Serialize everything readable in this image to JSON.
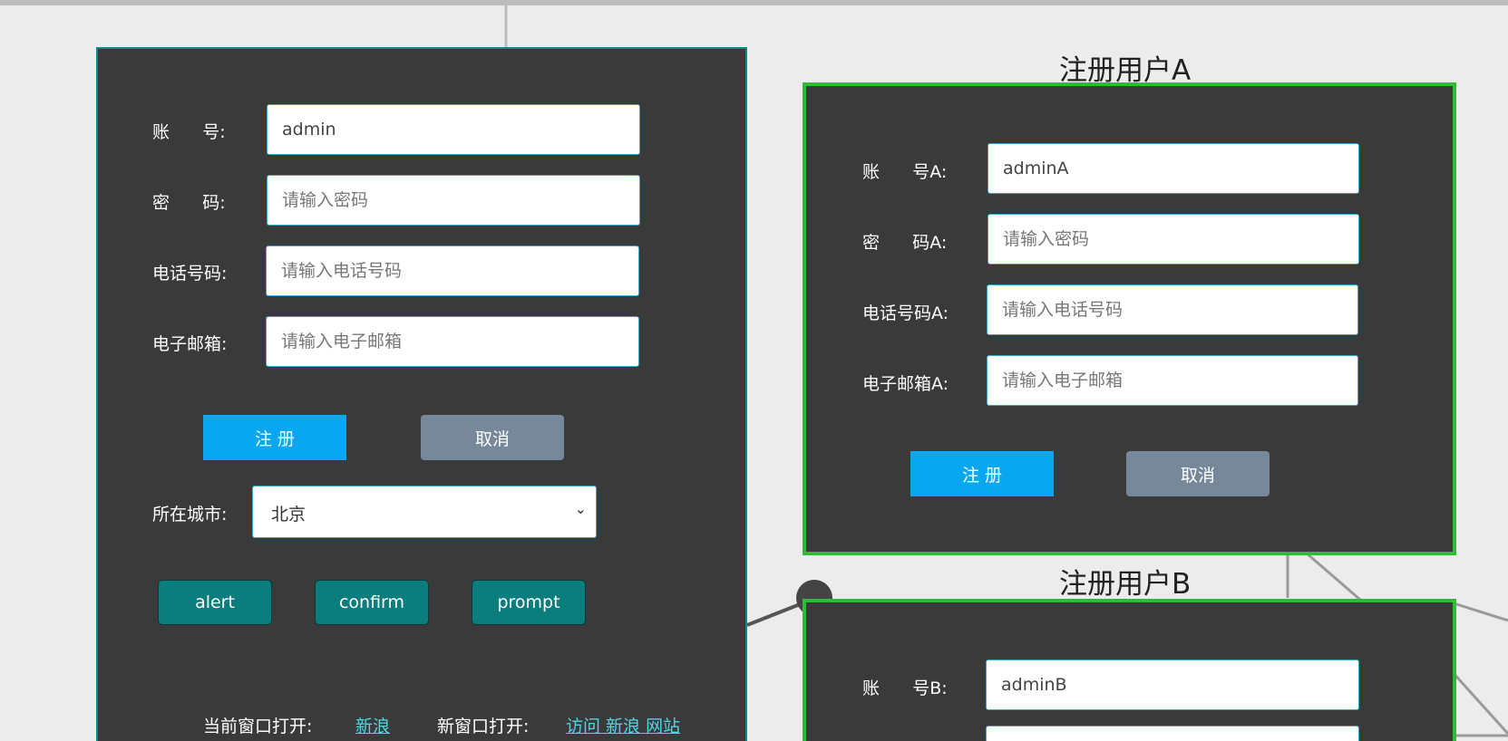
{
  "main_form": {
    "account": {
      "label": "账      号:",
      "value": "admin",
      "placeholder": ""
    },
    "password": {
      "label": "密      码:",
      "value": "",
      "placeholder": "请输入密码"
    },
    "phone": {
      "label": "电话号码:",
      "value": "",
      "placeholder": "请输入电话号码"
    },
    "email": {
      "label": "电子邮箱:",
      "value": "",
      "placeholder": "请输入电子邮箱"
    },
    "register_label": "注  册",
    "cancel_label": "取消",
    "city": {
      "label": "所在城市:",
      "selected": "北京"
    },
    "alert_label": "alert",
    "confirm_label": "confirm",
    "prompt_label": "prompt",
    "current_window": {
      "label": "当前窗口打开:",
      "link": "新浪"
    },
    "new_window": {
      "label": "新窗口打开:",
      "link": "访问 新浪 网站"
    }
  },
  "form_a": {
    "title": "注册用户A",
    "account": {
      "label": "账      号A:",
      "value": "adminA",
      "placeholder": ""
    },
    "password": {
      "label": "密      码A:",
      "value": "",
      "placeholder": "请输入密码"
    },
    "phone": {
      "label": "电话号码A:",
      "value": "",
      "placeholder": "请输入电话号码"
    },
    "email": {
      "label": "电子邮箱A:",
      "value": "",
      "placeholder": "请输入电子邮箱"
    },
    "register_label": "注  册",
    "cancel_label": "取消"
  },
  "form_b": {
    "title": "注册用户B",
    "account": {
      "label": "账      号B:",
      "value": "adminB",
      "placeholder": ""
    }
  },
  "colors": {
    "panel_bg": "#3a3a3a",
    "primary_button": "#08a7ef",
    "cancel_button": "#76889a",
    "teal_button": "#0b7d7c",
    "green_border": "#2fbb33",
    "link": "#4fd6e6"
  }
}
